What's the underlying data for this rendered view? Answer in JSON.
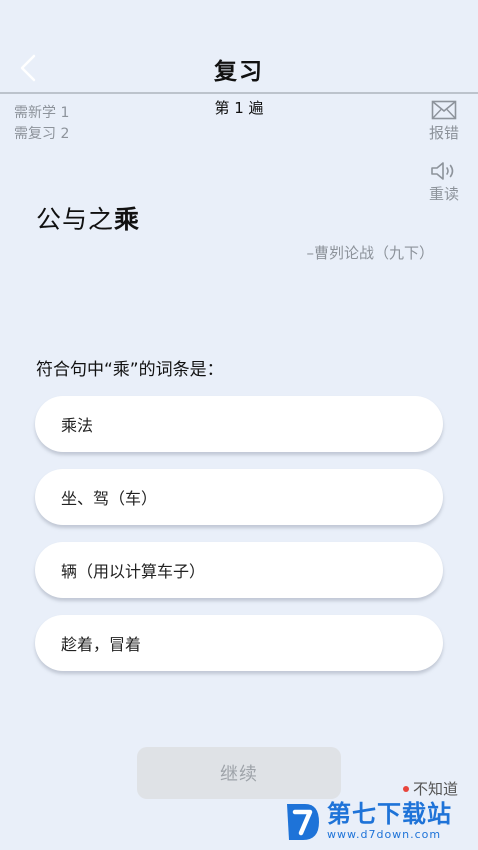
{
  "header": {
    "title": "复习",
    "back_icon": "chevron-left-icon"
  },
  "progress": {
    "pass_label": "第 1 遍",
    "new_label": "需新学 1",
    "review_label": "需复习 2"
  },
  "actions": {
    "report_label": "报错",
    "report_icon": "mail-icon",
    "reread_label": "重读",
    "reread_icon": "speaker-icon"
  },
  "card": {
    "phrase": "公与之",
    "target_char": "乘",
    "source": "–曹刿论战（九下）"
  },
  "quiz": {
    "question": "符合句中“乘”的词条是：",
    "options": [
      {
        "label": "乘法"
      },
      {
        "label": "坐、驾（车）"
      },
      {
        "label": "辆（用以计算车子）"
      },
      {
        "label": "趁着，冒着"
      }
    ]
  },
  "footer": {
    "continue_label": "继续",
    "dont_know_label": "不知道"
  },
  "watermark": {
    "title": "第七下载站",
    "url": "www.d7down.com"
  },
  "colors": {
    "background": "#e9eff9",
    "muted_text": "#8d939b",
    "dot": "#e8453c",
    "watermark": "#1e73d8"
  }
}
